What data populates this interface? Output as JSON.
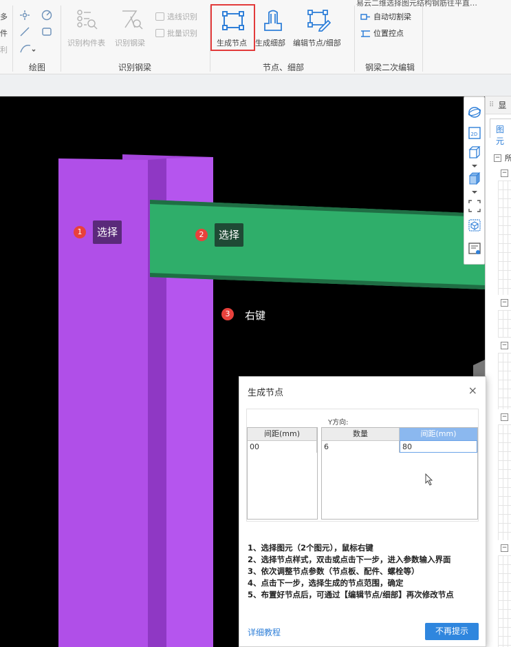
{
  "window": {
    "top_text": "易云二维选择图元结构钢筋往平直…"
  },
  "ribbon": {
    "left_partial": [
      "多",
      "件",
      "利"
    ],
    "groups": {
      "draw": "绘图",
      "recognize": "识别钢梁",
      "node": "节点、细部",
      "edit2": "钢梁二次编辑"
    },
    "items": {
      "recognize_table": "识别构件表",
      "recognize_beam": "识别钢梁",
      "select_recognize": "选线识别",
      "batch_recognize": "批量识别",
      "generate_node": "生成节点",
      "generate_detail": "生成细部",
      "edit_node": "编辑节点/细部",
      "auto_cut": "自动切割梁",
      "position_control": "位置控点"
    }
  },
  "canvas": {
    "callouts": [
      {
        "num": "1",
        "text": "选择"
      },
      {
        "num": "2",
        "text": "选择"
      },
      {
        "num": "3",
        "text": "右键"
      }
    ]
  },
  "right_panel": {
    "header": "显",
    "tab": "图元",
    "tree_root": "所"
  },
  "dialog": {
    "title": "生成节点",
    "close": "×",
    "y_direction": "Y方向:",
    "left_table": {
      "header": "间距(mm)",
      "value": "00"
    },
    "right_table": {
      "headers": [
        "数量",
        "间距(mm)"
      ],
      "values": [
        "6",
        "80"
      ]
    },
    "steps": [
      "1、选择图元（2个图元），鼠标右键",
      "2、选择节点样式，双击或点击下一步，进入参数输入界面",
      "3、依次调整节点参数（节点板、配件、螺栓等）",
      "4、点击下一步，选择生成的节点范围，确定",
      "5、布置好节点后，可通过【编辑节点/细部】再次修改节点"
    ],
    "link": "详细教程",
    "button": "不再提示"
  },
  "colors": {
    "column": "#b04fe8",
    "beam": "#2fae6a",
    "badge": "#e8413c",
    "primary": "#2f86de",
    "highlight": "#e23a3a"
  }
}
